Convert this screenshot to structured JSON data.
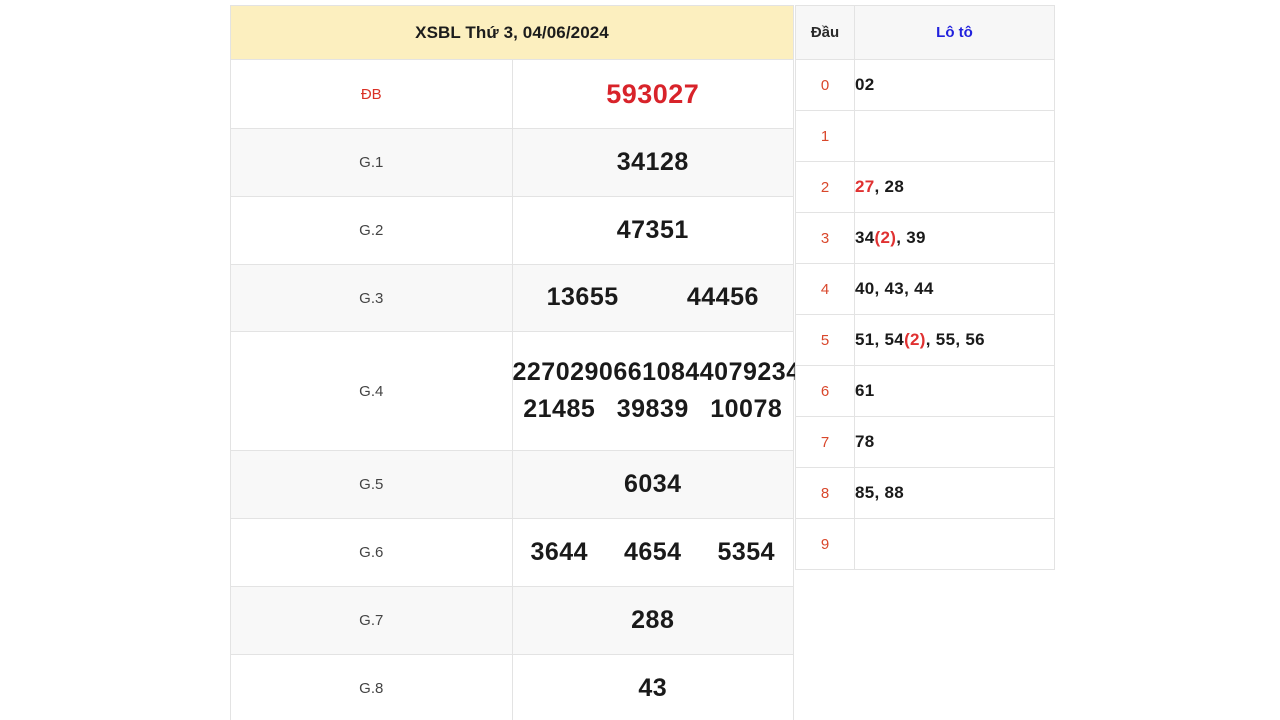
{
  "result_table": {
    "title": "XSBL Thứ 3, 04/06/2024",
    "rows": [
      {
        "label": "ĐB",
        "special": true,
        "cols": 1,
        "values": [
          "593027"
        ]
      },
      {
        "label": "G.1",
        "special": false,
        "cols": 1,
        "values": [
          "34128"
        ]
      },
      {
        "label": "G.2",
        "special": false,
        "cols": 1,
        "values": [
          "47351"
        ]
      },
      {
        "label": "G.3",
        "special": false,
        "cols": 2,
        "values": [
          "13655",
          "44456"
        ]
      },
      {
        "label": "G.4",
        "special": false,
        "cols": 4,
        "values": [
          "22702",
          "90661",
          "08440",
          "79234",
          "21485",
          "39839",
          "10078"
        ]
      },
      {
        "label": "G.5",
        "special": false,
        "cols": 1,
        "values": [
          "6034"
        ]
      },
      {
        "label": "G.6",
        "special": false,
        "cols": 3,
        "values": [
          "3644",
          "4654",
          "5354"
        ]
      },
      {
        "label": "G.7",
        "special": false,
        "cols": 1,
        "values": [
          "288"
        ]
      },
      {
        "label": "G.8",
        "special": false,
        "cols": 1,
        "values": [
          "43"
        ]
      }
    ],
    "labels": {
      "db": "ĐB",
      "g1": "G.1",
      "g2": "G.2",
      "g3": "G.3",
      "g4": "G.4",
      "g5": "G.5",
      "g6": "G.6",
      "g7": "G.7",
      "g8": "G.8"
    },
    "values": {
      "db": "593027",
      "g1": "34128",
      "g2": "47351",
      "g3_1": "13655",
      "g3_2": "44456",
      "g4_1": "22702",
      "g4_2": "90661",
      "g4_3": "08440",
      "g4_4": "79234",
      "g4_5": "21485",
      "g4_6": "39839",
      "g4_7": "10078",
      "g5": "6034",
      "g6_1": "3644",
      "g6_2": "4654",
      "g6_3": "5354",
      "g7": "288",
      "g8": "43"
    }
  },
  "loto_table": {
    "header_dau": "Đầu",
    "header_loto": "Lô tô",
    "rows": [
      {
        "dau": "0",
        "text": "02",
        "parts": [
          {
            "t": "02",
            "style": "plain"
          }
        ]
      },
      {
        "dau": "1",
        "text": "",
        "parts": []
      },
      {
        "dau": "2",
        "text": "27, 28",
        "parts": [
          {
            "t": "27",
            "style": "hl"
          },
          {
            "t": ", 28",
            "style": "plain"
          }
        ]
      },
      {
        "dau": "3",
        "text": "34(2), 39",
        "parts": [
          {
            "t": "34",
            "style": "plain"
          },
          {
            "t": "(2)",
            "style": "dup"
          },
          {
            "t": ", 39",
            "style": "plain"
          }
        ]
      },
      {
        "dau": "4",
        "text": "40, 43, 44",
        "parts": [
          {
            "t": "40, 43, 44",
            "style": "plain"
          }
        ]
      },
      {
        "dau": "5",
        "text": "51, 54(2), 55, 56",
        "parts": [
          {
            "t": "51, 54",
            "style": "plain"
          },
          {
            "t": "(2)",
            "style": "dup"
          },
          {
            "t": ", 55, 56",
            "style": "plain"
          }
        ]
      },
      {
        "dau": "6",
        "text": "61",
        "parts": [
          {
            "t": "61",
            "style": "plain"
          }
        ]
      },
      {
        "dau": "7",
        "text": "78",
        "parts": [
          {
            "t": "78",
            "style": "plain"
          }
        ]
      },
      {
        "dau": "8",
        "text": "85, 88",
        "parts": [
          {
            "t": "85, 88",
            "style": "plain"
          }
        ]
      },
      {
        "dau": "9",
        "text": "",
        "parts": []
      }
    ],
    "digits": {
      "d0": "0",
      "d1": "1",
      "d2": "2",
      "d3": "3",
      "d4": "4",
      "d5": "5",
      "d6": "6",
      "d7": "7",
      "d8": "8",
      "d9": "9"
    },
    "cells": {
      "c0": "02",
      "c1": "",
      "c2_hl": "27",
      "c2_rest": ", 28",
      "c3_a": "34",
      "c3_dup": "(2)",
      "c3_b": ", 39",
      "c4": "40, 43, 44",
      "c5_a": "51, 54",
      "c5_dup": "(2)",
      "c5_b": ", 55, 56",
      "c6": "61",
      "c7": "78",
      "c8": "85, 88",
      "c9": ""
    }
  },
  "colors": {
    "header_bg": "#fcefbf",
    "special_red": "#d8232a",
    "loto_blue": "#2222dd",
    "dau_red": "#d9472b",
    "border": "#e3e3e3",
    "row_shade": "#f8f8f8"
  }
}
